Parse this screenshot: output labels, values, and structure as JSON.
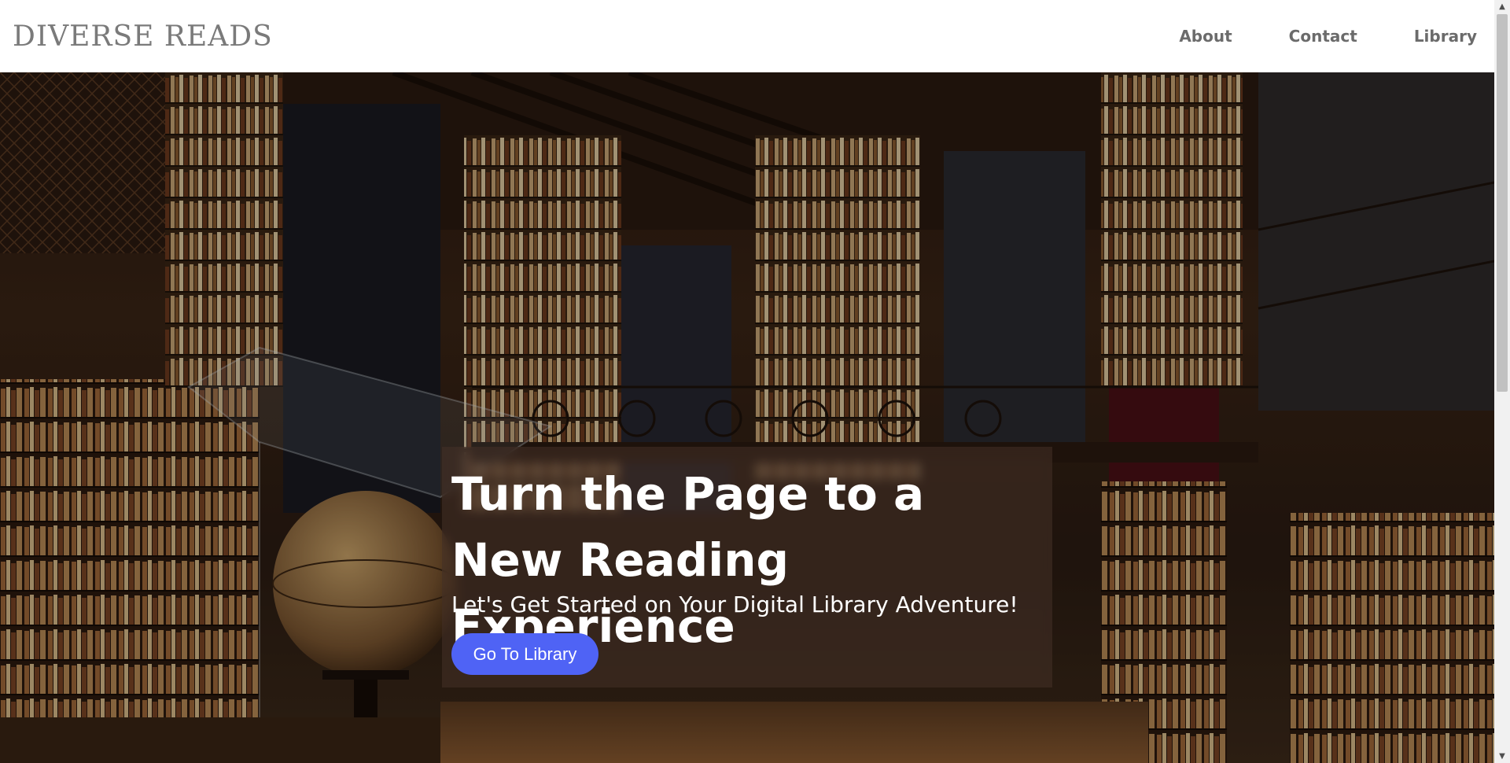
{
  "header": {
    "brand": "DIVERSE READS",
    "nav": [
      {
        "label": "About"
      },
      {
        "label": "Contact"
      },
      {
        "label": "Library"
      }
    ]
  },
  "hero": {
    "title": "Turn the Page to a New Reading Experience",
    "subtitle": "Let's Get Started on Your Digital Library Adventure!",
    "button_label": "Go To Library",
    "background_image": "library-interior-photo"
  },
  "scrollbar": {
    "up_icon": "▲",
    "down_icon": "▼"
  },
  "colors": {
    "accent": "#4f63f5",
    "brand_text": "#7a7a7a",
    "nav_text": "#6b6b6b"
  }
}
